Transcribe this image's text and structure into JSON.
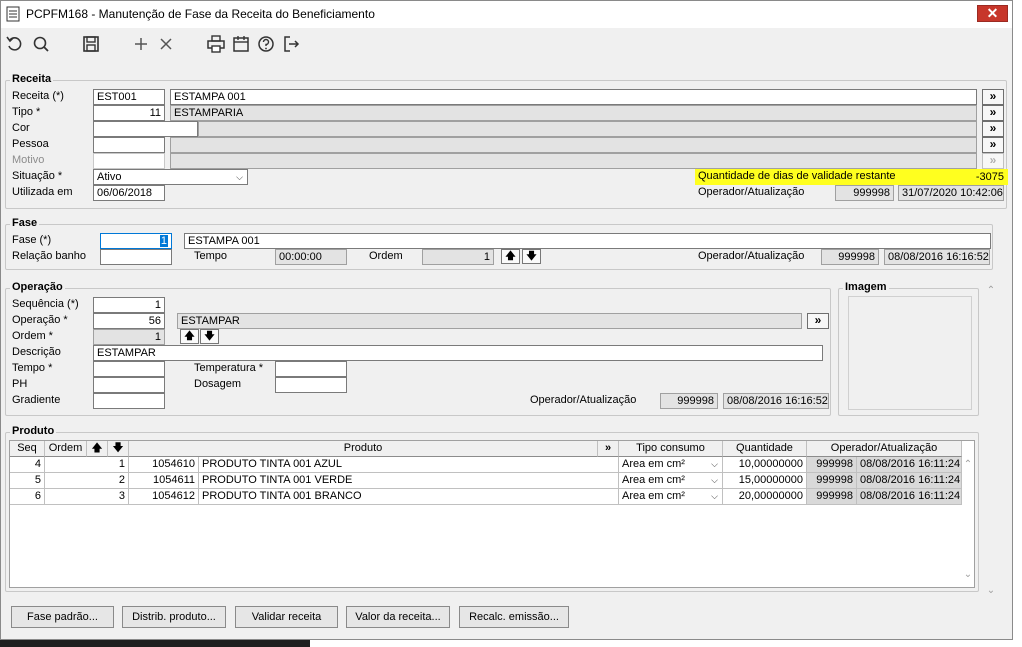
{
  "window": {
    "title": "PCPFM168 - Manutenção de Fase da Receita do Beneficiamento",
    "close": "✕"
  },
  "toolbar": {
    "buttons": [
      "undo-icon",
      "search-icon",
      "save-icon",
      "add-icon",
      "delete-icon",
      "print-icon",
      "calendar-icon",
      "help-icon",
      "exit-icon"
    ]
  },
  "receita": {
    "legend": "Receita",
    "receita_label": "Receita (*)",
    "receita_code": "EST001",
    "receita_desc": "ESTAMPA 001",
    "tipo_label": "Tipo *",
    "tipo_code": "11",
    "tipo_desc": "ESTAMPARIA",
    "cor_label": "Cor",
    "pessoa_label": "Pessoa",
    "motivo_label": "Motivo",
    "situacao_label": "Situação *",
    "situacao_value": "Ativo",
    "utilizada_label": "Utilizada em",
    "utilizada_value": "06/06/2018",
    "validade_label": "Quantidade de dias de validade restante",
    "validade_value": "-3075",
    "operador_label": "Operador/Atualização",
    "operador_code": "999998",
    "operador_date": "31/07/2020 10:42:06",
    "more": "»"
  },
  "fase": {
    "legend": "Fase",
    "fase_label": "Fase (*)",
    "fase_code": "1",
    "fase_desc": "ESTAMPA 001",
    "relacao_label": "Relação banho",
    "tempo_label": "Tempo",
    "tempo_value": "00:00:00",
    "ordem_label": "Ordem",
    "ordem_value": "1",
    "operador_label": "Operador/Atualização",
    "operador_code": "999998",
    "operador_date": "08/08/2016 16:16:52",
    "up": "🡅",
    "down": "🡇"
  },
  "operacao": {
    "legend": "Operação",
    "sequencia_label": "Sequência (*)",
    "sequencia_value": "1",
    "operacao_label": "Operação *",
    "operacao_code": "56",
    "operacao_desc": "ESTAMPAR",
    "ordem_label": "Ordem *",
    "ordem_value": "1",
    "descricao_label": "Descrição",
    "descricao_value": "ESTAMPAR",
    "tempo_label": "Tempo *",
    "temperatura_label": "Temperatura *",
    "ph_label": "PH",
    "dosagem_label": "Dosagem",
    "gradiente_label": "Gradiente",
    "operador_label": "Operador/Atualização",
    "operador_code": "999998",
    "operador_date": "08/08/2016 16:16:52"
  },
  "imagem": {
    "legend": "Imagem"
  },
  "produto": {
    "legend": "Produto",
    "headers": {
      "seq": "Seq",
      "ordem": "Ordem",
      "produto": "Produto",
      "more": "»",
      "tipo": "Tipo consumo",
      "qtd": "Quantidade",
      "oper": "Operador/Atualização"
    },
    "rows": [
      {
        "seq": "4",
        "ordem": "1",
        "code": "1054610",
        "name": "PRODUTO TINTA 001 AZUL",
        "tipo": "Area em cm²",
        "qtd": "10,00000000",
        "op": "999998",
        "date": "08/08/2016 16:11:24"
      },
      {
        "seq": "5",
        "ordem": "2",
        "code": "1054611",
        "name": "PRODUTO TINTA 001 VERDE",
        "tipo": "Area em cm²",
        "qtd": "15,00000000",
        "op": "999998",
        "date": "08/08/2016 16:11:24"
      },
      {
        "seq": "6",
        "ordem": "3",
        "code": "1054612",
        "name": "PRODUTO TINTA 001 BRANCO",
        "tipo": "Area em cm²",
        "qtd": "20,00000000",
        "op": "999998",
        "date": "08/08/2016 16:11:24"
      }
    ]
  },
  "buttons": {
    "fase_padrao": "Fase padrão...",
    "distrib": "Distrib. produto...",
    "validar": "Validar receita",
    "valor": "Valor da receita...",
    "recalc": "Recalc. emissão..."
  },
  "colors": {
    "highlight": "#ffff1f",
    "close": "#c7362a",
    "focus": "#0078d7"
  }
}
